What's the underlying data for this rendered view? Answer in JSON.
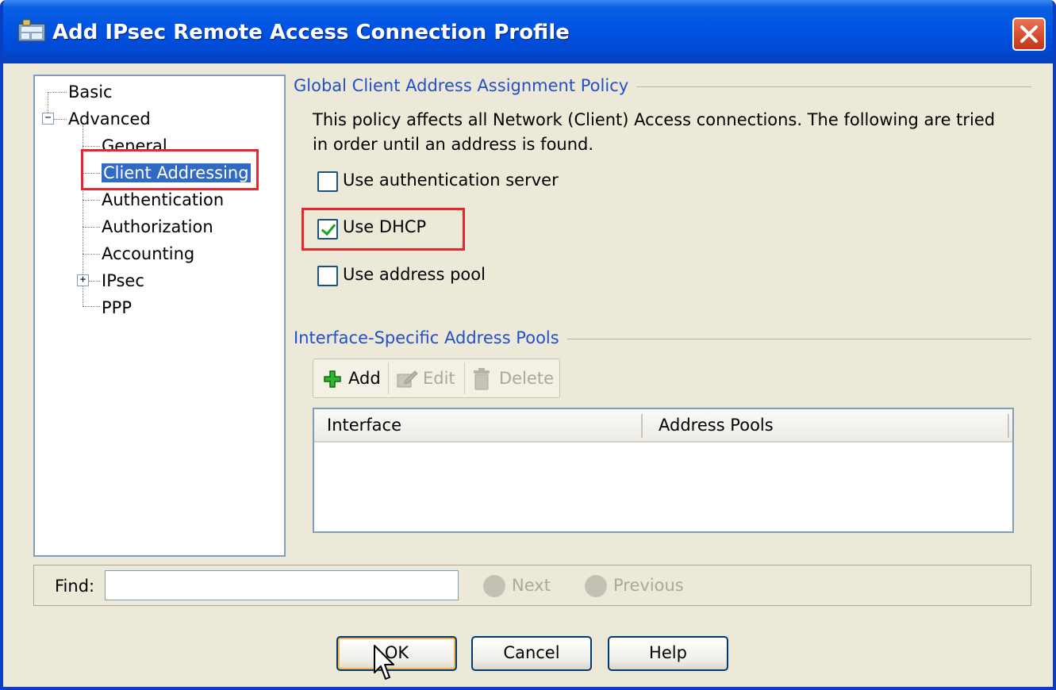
{
  "window": {
    "title": "Add IPsec Remote Access Connection Profile"
  },
  "tree": {
    "basic": "Basic",
    "advanced": "Advanced",
    "general": "General",
    "client_addressing": "Client Addressing",
    "authentication": "Authentication",
    "authorization": "Authorization",
    "accounting": "Accounting",
    "ipsec": "IPsec",
    "ppp": "PPP",
    "advanced_expander": "−",
    "ipsec_expander": "+"
  },
  "global_policy": {
    "heading": "Global Client Address Assignment Policy",
    "description": "This policy affects all Network (Client) Access connections. The following are tried in order until an address is found.",
    "options": [
      {
        "label": "Use authentication server",
        "checked": false
      },
      {
        "label": "Use DHCP",
        "checked": true
      },
      {
        "label": "Use address pool",
        "checked": false
      }
    ]
  },
  "interface_pools": {
    "heading": "Interface-Specific Address Pools",
    "toolbar": {
      "add": "Add",
      "edit": "Edit",
      "delete": "Delete"
    },
    "columns": [
      "Interface",
      "Address Pools"
    ],
    "rows": []
  },
  "find": {
    "label": "Find:",
    "value": "",
    "next": "Next",
    "previous": "Previous"
  },
  "buttons": {
    "ok": "OK",
    "cancel": "Cancel",
    "help": "Help"
  },
  "colors": {
    "highlight_box": "#e8262f",
    "selection": "#316ac5",
    "heading_blue": "#2350c8"
  }
}
